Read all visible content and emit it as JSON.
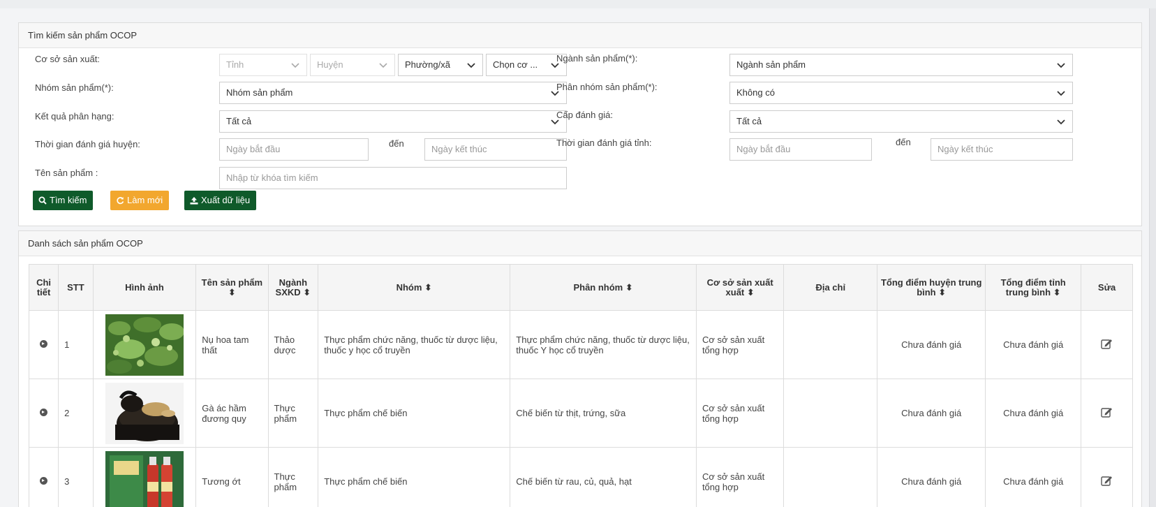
{
  "search": {
    "title": "Tìm kiếm sản phẩm OCOP",
    "labels": {
      "facility": "Cơ sở sản xuất:",
      "group": "Nhóm sản phẩm(*):",
      "result": "Kết quả phân hạng:",
      "district_time": "Thời gian đánh giá huyện:",
      "product_name": "Tên sản phẩm :",
      "industry": "Ngành sản phẩm(*):",
      "subgroup": "Phân nhóm sản phẩm(*):",
      "level": "Cấp đánh giá:",
      "province_time": "Thời gian đánh giá tỉnh:",
      "to1": "đến",
      "to2": "đến"
    },
    "selects": {
      "province": "Tỉnh",
      "district": "Huyện",
      "ward": "Phường/xã",
      "facility": "Chọn cơ ...",
      "group": "Nhóm sản phẩm",
      "result": "Tất cả",
      "industry": "Ngành sản phẩm",
      "subgroup": "Không có",
      "level": "Tất cả"
    },
    "placeholders": {
      "district_start": "Ngày bắt đầu",
      "district_end": "Ngày kết thúc",
      "province_start": "Ngày bắt đầu",
      "province_end": "Ngày kết thúc",
      "keyword": "Nhập từ khóa tìm kiếm"
    },
    "buttons": {
      "search": "Tìm kiếm",
      "reset": "Làm mới",
      "export": "Xuất dữ liệu"
    }
  },
  "list": {
    "title": "Danh sách sản phẩm OCOP",
    "columns": {
      "detail": "Chi tiết",
      "stt": "STT",
      "image": "Hình ảnh",
      "name": "Tên sản phẩm ⬍",
      "industry": "Ngành SXKD ⬍",
      "group": "Nhóm ⬍",
      "subgroup": "Phân nhóm ⬍",
      "facility": "Cơ sở sản xuất xuất ⬍",
      "address": "Địa chỉ",
      "district_score": "Tổng điểm huyện trung bình ⬍",
      "province_score": "Tổng điểm tỉnh trung bình ⬍",
      "edit": "Sửa"
    },
    "rows": [
      {
        "stt": "1",
        "name": "Nụ hoa tam thất",
        "industry": "Thảo dược",
        "group": "Thực phẩm chức năng, thuốc từ dược liệu, thuốc y học cổ truyền",
        "subgroup": "Thực phẩm chức năng, thuốc từ dược liệu, thuốc Y học cổ truyền",
        "facility": "Cơ sở sản xuất tổng hợp",
        "address": "",
        "district_score": "Chưa đánh giá",
        "province_score": "Chưa đánh giá"
      },
      {
        "stt": "2",
        "name": "Gà ác hầm đương quy",
        "industry": "Thực phẩm",
        "group": "Thực phẩm chế biến",
        "subgroup": "Chế biến từ thịt, trứng, sữa",
        "facility": "Cơ sở sản xuất tổng hợp",
        "address": "",
        "district_score": "Chưa đánh giá",
        "province_score": "Chưa đánh giá"
      },
      {
        "stt": "3",
        "name": "Tương ớt",
        "industry": "Thực phẩm",
        "group": "Thực phẩm chế biến",
        "subgroup": "Chế biến từ rau, củ, quả, hạt",
        "facility": "Cơ sở sản xuất tổng hợp",
        "address": "",
        "district_score": "Chưa đánh giá",
        "province_score": "Chưa đánh giá"
      }
    ]
  },
  "colors": {
    "green": "#0f5a2a",
    "orange": "#f2a72e"
  }
}
